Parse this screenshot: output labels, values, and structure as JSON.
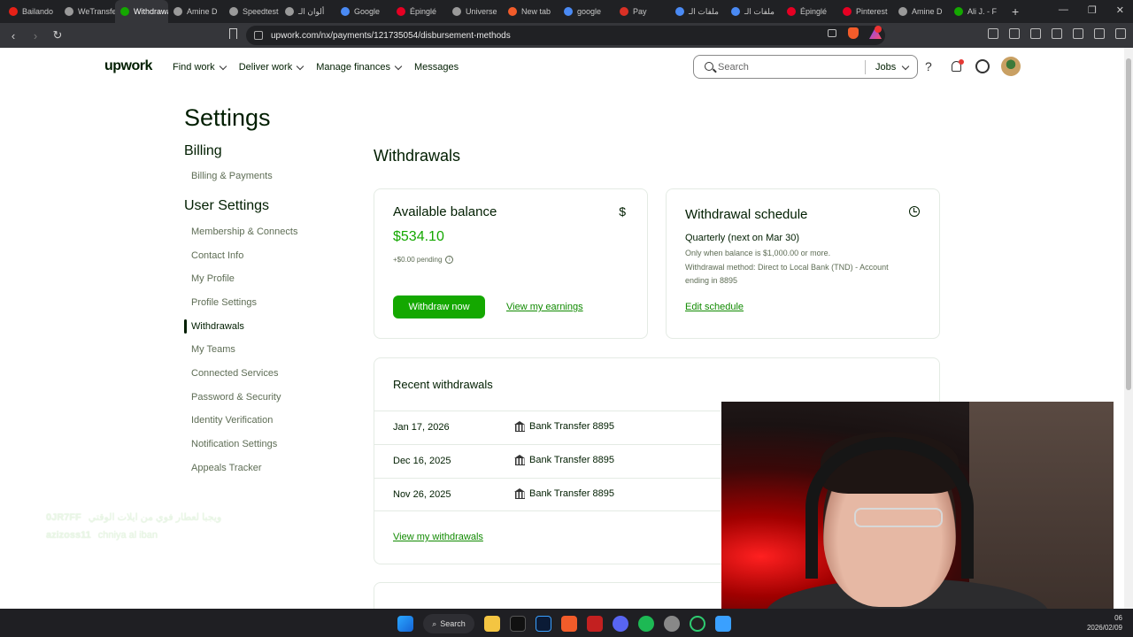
{
  "browser": {
    "tabs": [
      {
        "label": "Bailando",
        "color": "#e62117"
      },
      {
        "label": "WeTransfer",
        "color": "#9a9a9a"
      },
      {
        "label": "Withdrawals",
        "color": "#14a800"
      },
      {
        "label": "Amine D",
        "color": "#9a9a9a"
      },
      {
        "label": "Speedtest",
        "color": "#9a9a9a"
      },
      {
        "label": "ألوان الـ",
        "color": "#9a9a9a"
      },
      {
        "label": "Google",
        "color": "#4a8af4"
      },
      {
        "label": "Épinglé",
        "color": "#e60023"
      },
      {
        "label": "Universe",
        "color": "#9a9a9a"
      },
      {
        "label": "New tab",
        "color": "#f25c2a"
      },
      {
        "label": "google",
        "color": "#4a8af4"
      },
      {
        "label": "Pay",
        "color": "#d93025"
      },
      {
        "label": "ملفات الـ",
        "color": "#4a8af4"
      },
      {
        "label": "ملفات الـ",
        "color": "#4a8af4"
      },
      {
        "label": "Épinglé",
        "color": "#e60023"
      },
      {
        "label": "Pinterest",
        "color": "#e60023"
      },
      {
        "label": "Amine D",
        "color": "#9a9a9a"
      },
      {
        "label": "Ali J. - F",
        "color": "#14a800"
      }
    ],
    "active_tab_index": 2,
    "url": "upwork.com/nx/payments/121735054/disbursement-methods"
  },
  "header": {
    "logo": "upwork",
    "nav": [
      "Find work",
      "Deliver work",
      "Manage finances",
      "Messages"
    ],
    "search_placeholder": "Search",
    "search_scope": "Jobs"
  },
  "sidebar": {
    "title": "Settings",
    "billing_title": "Billing",
    "billing_items": [
      "Billing & Payments"
    ],
    "user_title": "User Settings",
    "user_items": [
      "Membership & Connects",
      "Contact Info",
      "My Profile",
      "Profile Settings",
      "Withdrawals",
      "My Teams",
      "Connected Services",
      "Password & Security",
      "Identity Verification",
      "Notification Settings",
      "Appeals Tracker"
    ],
    "active_item": "Withdrawals"
  },
  "main": {
    "title": "Withdrawals",
    "balance_card": {
      "title": "Available balance",
      "amount": "$534.10",
      "pending": "+$0.00 pending",
      "withdraw_button": "Withdraw now",
      "earnings_link": "View my earnings"
    },
    "schedule_card": {
      "title": "Withdrawal schedule",
      "frequency": "Quarterly (next on Mar 30)",
      "threshold": "Only when balance is $1,000.00 or more.",
      "method": "Withdrawal method: Direct to Local Bank (TND) - Account ending in 8895",
      "edit_link": "Edit schedule"
    },
    "recent": {
      "title": "Recent withdrawals",
      "rows": [
        {
          "date": "Jan 17, 2026",
          "method": "Bank Transfer 8895"
        },
        {
          "date": "Dec 16, 2025",
          "method": "Bank Transfer 8895"
        },
        {
          "date": "Nov 26, 2025",
          "method": "Bank Transfer 8895"
        }
      ],
      "view_link": "View my withdrawals"
    }
  },
  "overlay": {
    "line1_name": "0JR7FF",
    "line1_text": "ويجبا لعطار فوي من ايلات الوقتي",
    "line2_name": "azizoss11",
    "line2_text": "chniya al iban"
  },
  "taskbar": {
    "search_label": "Search",
    "clock_time": "06",
    "clock_date": "2026/02/09"
  },
  "colors": {
    "accent": "#14a800",
    "link": "#108a00"
  }
}
